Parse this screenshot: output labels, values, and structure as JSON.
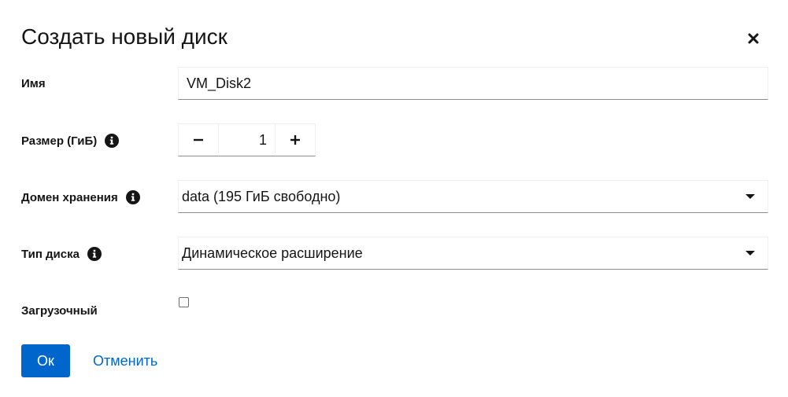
{
  "dialog": {
    "title": "Создать новый диск"
  },
  "fields": {
    "name": {
      "label": "Имя",
      "value": "VM_Disk2"
    },
    "size": {
      "label": "Размер (ГиБ)",
      "value": "1",
      "decrement_icon": "minus-icon",
      "increment_icon": "plus-icon"
    },
    "storage_domain": {
      "label": "Домен хранения",
      "selected": "data (195 ГиБ свободно)"
    },
    "disk_type": {
      "label": "Тип диска",
      "selected": "Динамическое расширение"
    },
    "bootable": {
      "label": "Загрузочный",
      "checked": false
    }
  },
  "actions": {
    "ok_label": "Ок",
    "cancel_label": "Отменить"
  },
  "colors": {
    "primary": "#0066cc",
    "text": "#151515",
    "border": "#8a8d90"
  }
}
